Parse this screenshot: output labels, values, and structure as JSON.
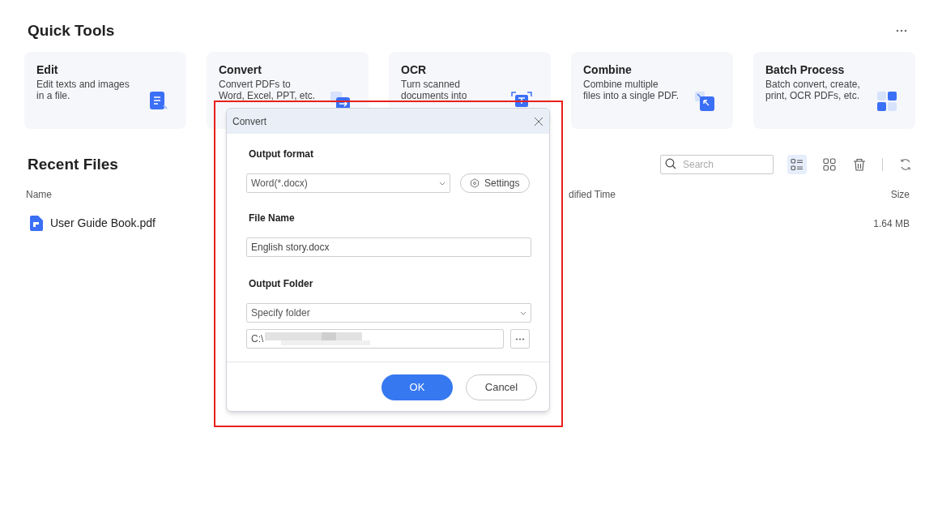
{
  "quick_tools": {
    "title": "Quick Tools",
    "tools": [
      {
        "kind": "edit",
        "title": "Edit",
        "description": "Edit texts and images\nin a file."
      },
      {
        "kind": "convert",
        "title": "Convert",
        "description": "Convert PDFs to\nWord, Excel, PPT, etc."
      },
      {
        "kind": "ocr",
        "title": "OCR",
        "description": "Turn scanned\ndocuments into"
      },
      {
        "kind": "combine",
        "title": "Combine",
        "description": "Combine multiple\nfiles into a single PDF."
      },
      {
        "kind": "batch",
        "title": "Batch Process",
        "description": "Batch convert, create,\nprint, OCR PDFs, etc."
      }
    ]
  },
  "recent_files": {
    "title": "Recent Files",
    "search": {
      "placeholder": "Search"
    },
    "views": [
      {
        "kind": "list",
        "selected": true
      },
      {
        "kind": "grid",
        "selected": false
      }
    ],
    "columns": [
      "Name",
      "dified Time",
      "Size"
    ],
    "rows": [
      {
        "name": "User Guide Book.pdf",
        "size": "1.64 MB"
      }
    ]
  },
  "dialog": {
    "title": "Convert",
    "output_format": {
      "label": "Output format",
      "value": "Word(*.docx)",
      "settings": "Settings"
    },
    "file_name": {
      "label": "File Name",
      "value": "English story.docx"
    },
    "output_folder": {
      "label": "Output Folder",
      "value": "Specify folder",
      "path": "C:\\"
    },
    "buttons": [
      {
        "kind": "primary",
        "label": "OK"
      },
      {
        "kind": "secondary",
        "label": "Cancel"
      }
    ]
  }
}
